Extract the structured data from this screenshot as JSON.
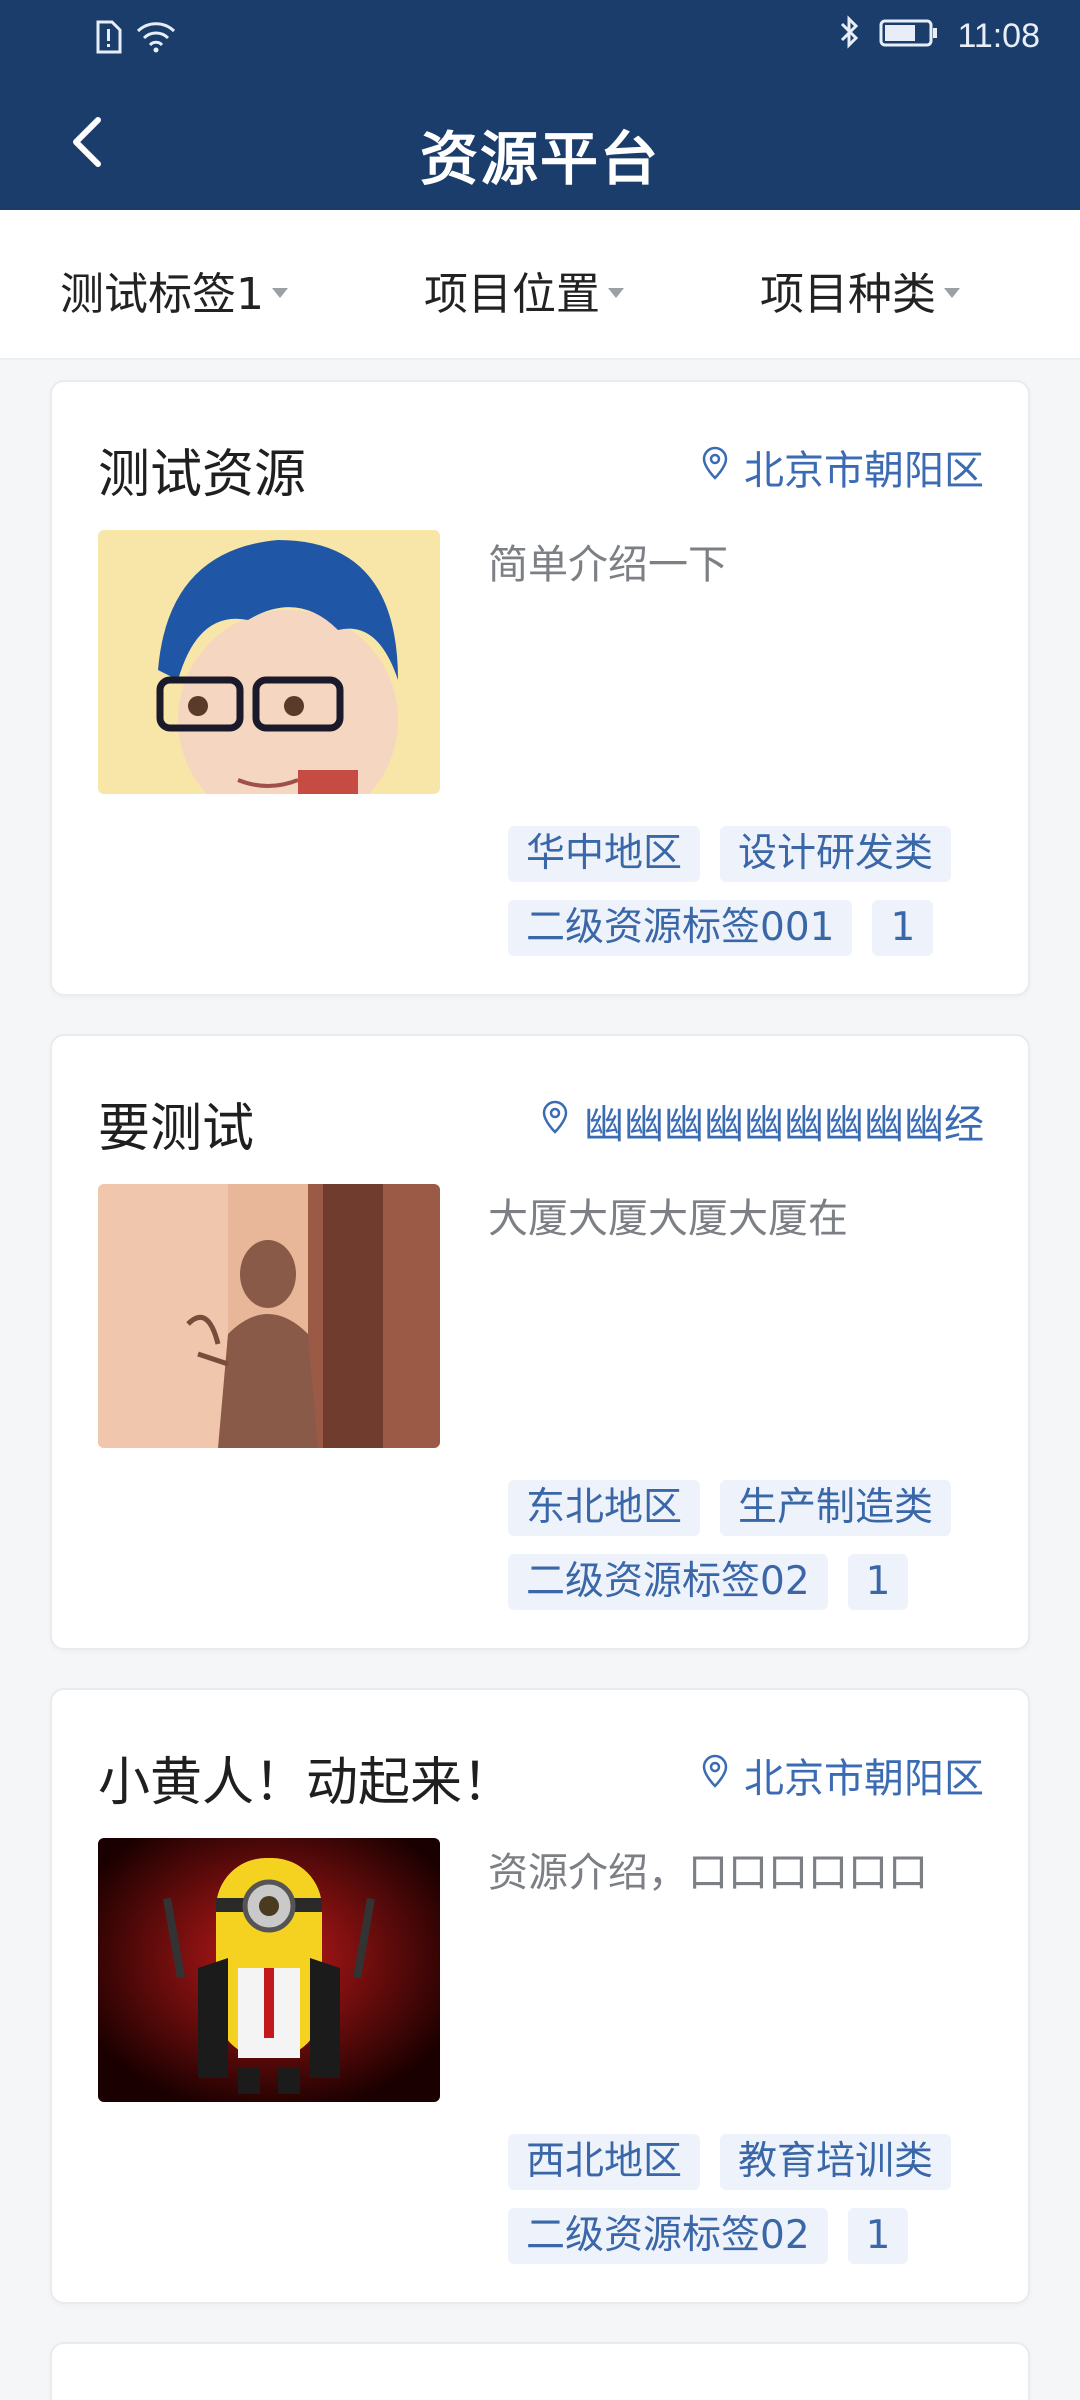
{
  "status": {
    "time": "11:08"
  },
  "header": {
    "title": "资源平台"
  },
  "filters": [
    {
      "label": "测试标签1"
    },
    {
      "label": "项目位置"
    },
    {
      "label": "项目种类"
    }
  ],
  "cards": [
    {
      "title": "测试资源",
      "location": "北京市朝阳区",
      "description": "简单介绍一下",
      "tags": [
        "华中地区",
        "设计研发类",
        "二级资源标签001",
        "1"
      ]
    },
    {
      "title": "要测试",
      "location": "幽幽幽幽幽幽幽幽幽经",
      "description": "大厦大厦大厦大厦在",
      "tags": [
        "东北地区",
        "生产制造类",
        "二级资源标签02",
        "1"
      ]
    },
    {
      "title": "小黄人！动起来！",
      "location": "北京市朝阳区",
      "description": "资源介绍，口口口口口口",
      "tags": [
        "西北地区",
        "教育培训类",
        "二级资源标签02",
        "1"
      ]
    }
  ]
}
